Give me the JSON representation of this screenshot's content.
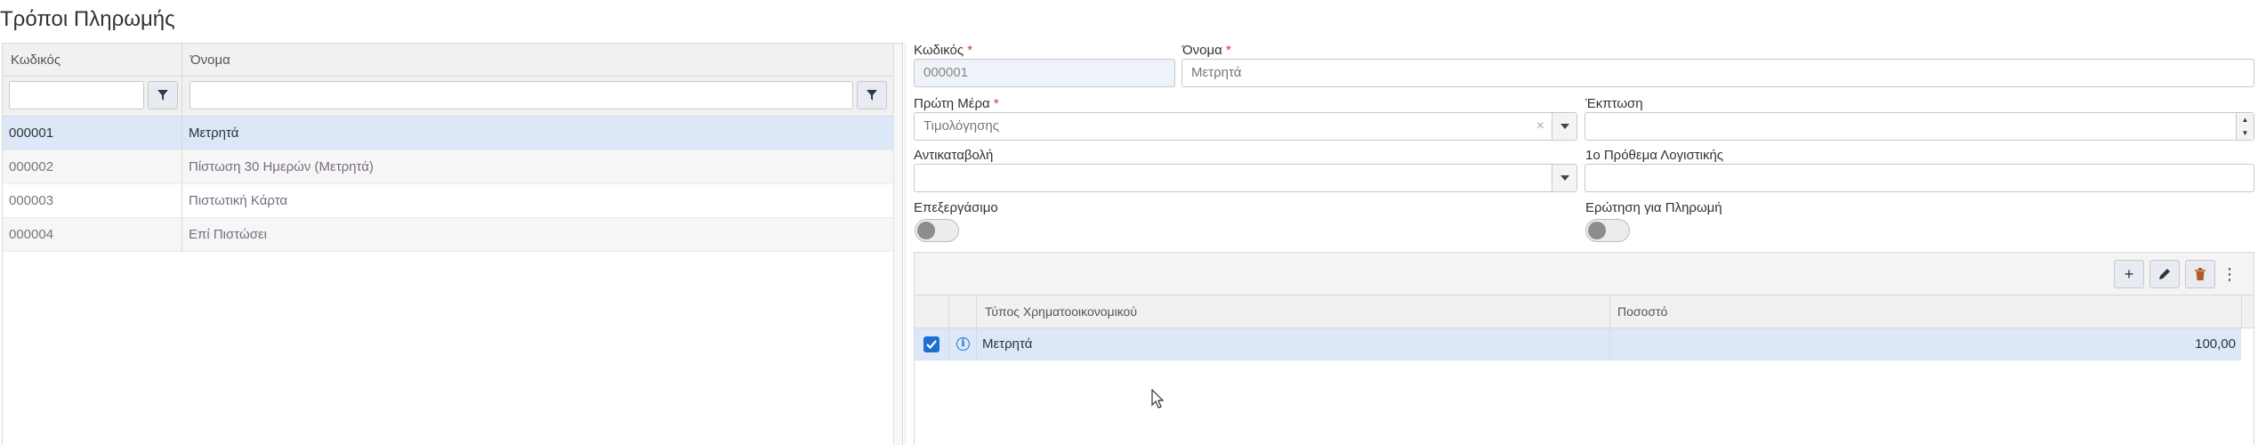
{
  "page": {
    "title": "Τρόποι Πληρωμής"
  },
  "list": {
    "columns": [
      "Κωδικός",
      "Όνομα"
    ],
    "filter": {
      "code_value": "",
      "name_value": ""
    },
    "rows": [
      {
        "code": "000001",
        "name": "Μετρητά",
        "selected": true
      },
      {
        "code": "000002",
        "name": "Πίστωση 30 Ημερών (Μετρητά)",
        "selected": false
      },
      {
        "code": "000003",
        "name": "Πιστωτική Κάρτα",
        "selected": false
      },
      {
        "code": "000004",
        "name": "Επί Πιστώσει",
        "selected": false
      }
    ]
  },
  "form": {
    "code": {
      "label": "Κωδικός",
      "required": "*",
      "value": "000001"
    },
    "name": {
      "label": "Όνομα",
      "required": "*",
      "value": "Μετρητά"
    },
    "first_day": {
      "label": "Πρώτη Μέρα",
      "required": "*",
      "value": "Τιμολόγησης",
      "clear": "×"
    },
    "discount": {
      "label": "Έκπτωση",
      "value": ""
    },
    "cod": {
      "label": "Αντικαταβολή",
      "value": ""
    },
    "acct_prefix": {
      "label": "1ο Πρόθεμα Λογιστικής",
      "value": ""
    },
    "editable": {
      "label": "Επεξεργάσιμο",
      "on": false
    },
    "payment_prompt": {
      "label": "Ερώτηση για Πληρωμή",
      "on": false
    }
  },
  "details": {
    "toolbar": {
      "add": "+",
      "more": "⋮"
    },
    "columns": [
      "Τύπος Χρηματοοικονομικού",
      "Ποσοστό"
    ],
    "rows": [
      {
        "type": "Μετρητά",
        "percent": "100,00",
        "checked": true
      }
    ]
  },
  "colors": {
    "selected_row": "#dce8f8",
    "accent": "#1f6fd0",
    "required": "#dd3333"
  }
}
